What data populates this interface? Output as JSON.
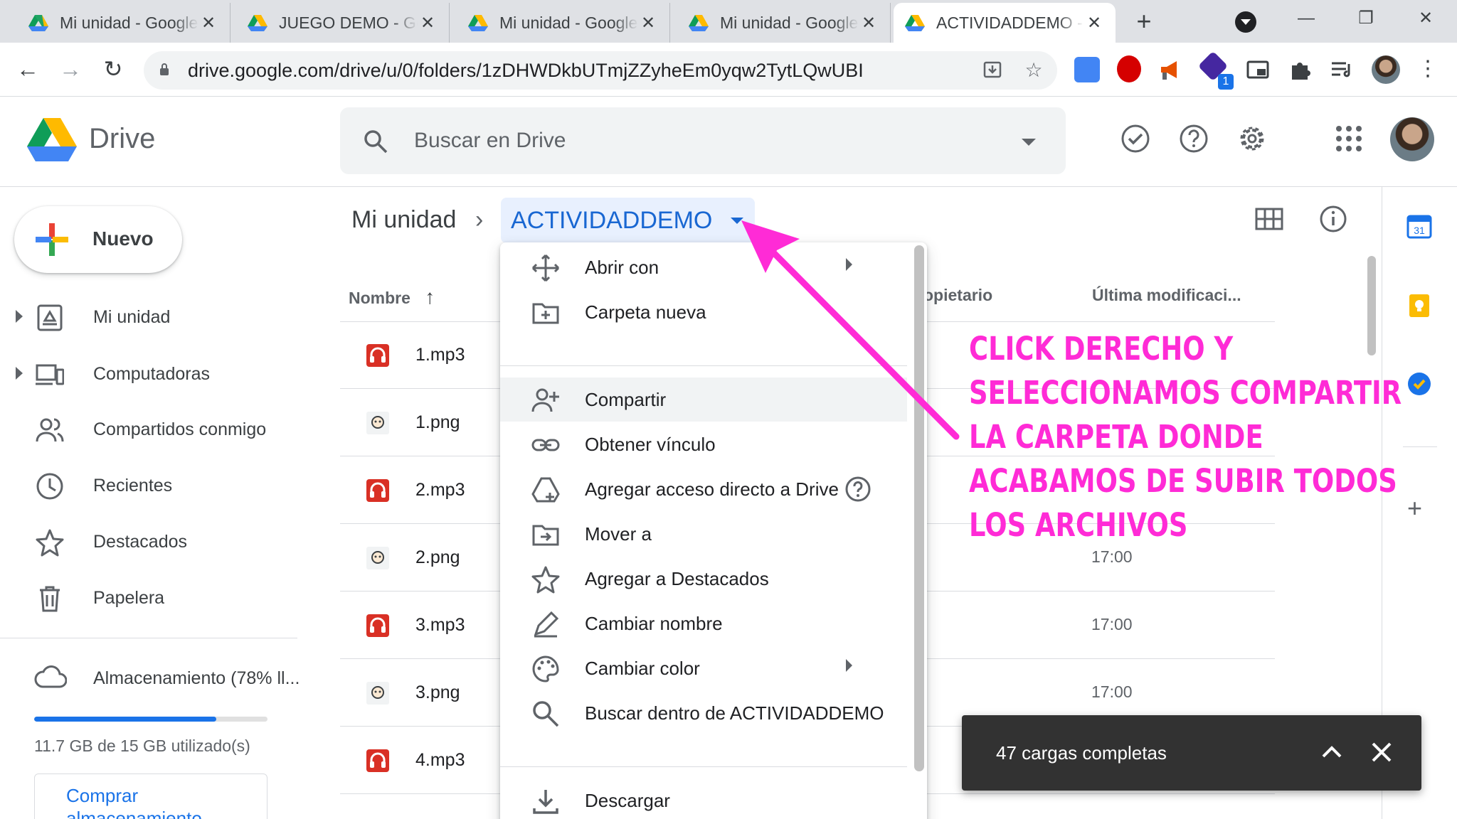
{
  "browser": {
    "tabs": [
      {
        "title": "Mi unidad - Google Drive"
      },
      {
        "title": "JUEGO DEMO - Google Drive"
      },
      {
        "title": "Mi unidad - Google Drive"
      },
      {
        "title": "Mi unidad - Google Drive"
      },
      {
        "title": "ACTIVIDADDEMO - Google Drive"
      }
    ],
    "url": "drive.google.com/drive/u/0/folders/1zDHWDkbUTmjZZyheEm0yqw2TytLQwUBI",
    "new_tab": "+",
    "minimize": "—",
    "restore": "❐",
    "close": "✕",
    "back": "←",
    "forward": "→",
    "reload": "↻",
    "star": "☆",
    "menu_dots": "⋮",
    "ext_badge": "1"
  },
  "drive": {
    "logo_text": "Drive",
    "search_placeholder": "Buscar en Drive",
    "new_button": "Nuevo",
    "nav": [
      {
        "label": "Mi unidad",
        "icon": "my-drive-icon"
      },
      {
        "label": "Computadoras",
        "icon": "computers-icon"
      },
      {
        "label": "Compartidos conmigo",
        "icon": "shared-icon"
      },
      {
        "label": "Recientes",
        "icon": "clock-icon"
      },
      {
        "label": "Destacados",
        "icon": "star-icon"
      },
      {
        "label": "Papelera",
        "icon": "trash-icon"
      }
    ],
    "storage": {
      "label": "Almacenamiento (78% ll...",
      "used_text": "11.7 GB de 15 GB utilizado(s)",
      "fraction_used": 0.78,
      "buy": "Comprar almacenamiento"
    },
    "breadcrumb": {
      "root": "Mi unidad",
      "separator": "›",
      "current": "ACTIVIDADDEMO"
    },
    "columns": {
      "name": "Nombre",
      "sort": "↑",
      "owner": "opietario",
      "modified": "Última modificaci..."
    },
    "files": [
      {
        "name": "1.mp3",
        "type": "audio",
        "modified": ""
      },
      {
        "name": "1.png",
        "type": "image",
        "modified": ""
      },
      {
        "name": "2.mp3",
        "type": "audio",
        "modified": ""
      },
      {
        "name": "2.png",
        "type": "image",
        "modified": "17:00"
      },
      {
        "name": "3.mp3",
        "type": "audio",
        "modified": "17:00"
      },
      {
        "name": "3.png",
        "type": "image",
        "modified": "17:00"
      },
      {
        "name": "4.mp3",
        "type": "audio",
        "modified": ""
      }
    ],
    "side_plus": "+"
  },
  "context_menu": {
    "items": [
      {
        "label": "Abrir con",
        "icon": "open-with-icon",
        "submenu": true
      },
      {
        "label": "Carpeta nueva",
        "icon": "new-folder-icon"
      },
      {
        "label": "Compartir",
        "icon": "share-icon",
        "hover": true
      },
      {
        "label": "Obtener vínculo",
        "icon": "link-icon"
      },
      {
        "label": "Agregar acceso directo a Drive",
        "icon": "shortcut-icon",
        "help": true
      },
      {
        "label": "Mover a",
        "icon": "move-icon"
      },
      {
        "label": "Agregar a Destacados",
        "icon": "star-icon"
      },
      {
        "label": "Cambiar nombre",
        "icon": "rename-icon"
      },
      {
        "label": "Cambiar color",
        "icon": "palette-icon",
        "submenu": true
      },
      {
        "label": "Buscar dentro de ACTIVIDADDEMO",
        "icon": "search-icon"
      },
      {
        "label": "Descargar",
        "icon": "download-icon"
      }
    ]
  },
  "annotation": {
    "text": "CLICK DERECHO Y SELECCIONAMOS COMPARTIR LA CARPETA DONDE ACABAMOS DE SUBIR TODOS LOS ARCHIVOS",
    "color": "#ff2bd6"
  },
  "toast": {
    "text": "47 cargas completas"
  },
  "colors": {
    "accent": "#1a73e8",
    "breadcrumb_bg": "#e8f0fe",
    "toast_bg": "#323232"
  }
}
